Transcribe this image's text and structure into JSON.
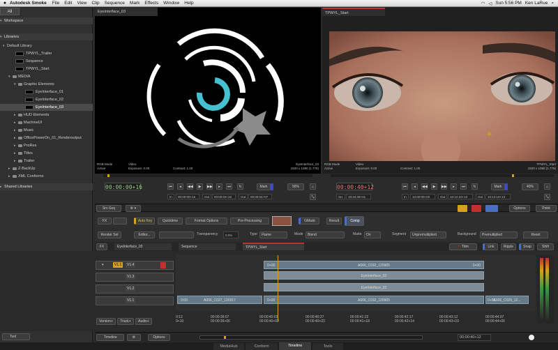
{
  "menubar": {
    "app": "Autodesk Smoke",
    "items": [
      "File",
      "Edit",
      "View",
      "Clip",
      "Sequence",
      "Mark",
      "Effects",
      "Window",
      "Help"
    ],
    "clock": "Sun 5:56 PM",
    "user": "Ken LaRue"
  },
  "library": {
    "tab": "All",
    "workspace": "Workspace",
    "libraries": "Libraries",
    "default_library": "Default Library",
    "tpwyl_trailer": "TPWYL_Trailer",
    "sequence": "Sequence",
    "tpwyl_start": "TPWYL_Start",
    "media": "MEDIA",
    "graphic_elements": "Graphic Elements",
    "eye1": "EyeInterface_01",
    "eye2": "EyeInterface_02",
    "eye3": "EyeInterface_03",
    "hud": "HUD Elements",
    "machineui": "MachineUI",
    "music": "Music",
    "officepower": "OfficePowerOn_01_Renderoutput",
    "prores": "ProRes",
    "titles": "Titles",
    "trailer": "Trailer",
    "zbackup": "Z-BackUp",
    "xml": "XML Conforms",
    "shared": "Shared Libraries"
  },
  "viewerL": {
    "tab": "EyeInterface_03",
    "mode": "RGB Mode",
    "active": "Active",
    "video": "Video",
    "exposure": "Exposure: 0.00",
    "contrast": "Contrast: 1.00",
    "name": "EyeInterface_03",
    "res": "1920 x 1080 (1.778)"
  },
  "viewerR": {
    "tab": "TPWYL_Start",
    "mode": "RGB Mode",
    "active": "Active",
    "video": "Video",
    "exposure": "Exposure: 0.00",
    "contrast": "Contrast: 1.00",
    "name": "TPWYL_Start",
    "res": "1920 x 1080 (1.778)"
  },
  "transportL": {
    "tc": "00:00:00+16",
    "mark": "Mark",
    "zoom": "56%",
    "in_label": "In",
    "in": "00:00:00+16",
    "out_label": "Out",
    "out": "00:00:04+22",
    "out2_label": "Out",
    "out2": "00:00:04+07",
    "srcseq": "Src-Seq"
  },
  "transportR": {
    "tc": "00:00:40+12",
    "mark": "Mark",
    "zoom": "40%",
    "src_label": "Src",
    "src": "19:34:39+01",
    "in_label": "In",
    "in": "10:00:00+00",
    "out_label": "Out",
    "out": "10:12:10+12",
    "out2_label": "Out",
    "out2": "10:12:10+13",
    "options": "Options",
    "pointer": "Point"
  },
  "fx": {
    "fx": "FX",
    "autokey": "Auto Key",
    "quicktime": "Quicktime",
    "format": "Format Options",
    "preproc": "Pre-Processing",
    "gmask": "GMask",
    "result": "Result",
    "comp": "Comp",
    "render": "Render Sel",
    "editor": "Editor...",
    "transparency": "Transparency",
    "transparency_val": "0.0%",
    "type": "Type",
    "type_val": "Flame",
    "mode": "Mode",
    "mode_val": "Blend",
    "matte": "Matte",
    "matte_val": "On",
    "segment": "Segment",
    "segment_val": "Unpremultiplied",
    "background": "Background",
    "background_val": "Premultiplied",
    "reset": "Reset"
  },
  "timeline": {
    "fxtab": "FX",
    "tab1": "EyeInterface_03",
    "tab2": "Sequence",
    "tab3": "TPWYL_Start",
    "trim": "Trim",
    "link": "Link",
    "ripple": "Ripple",
    "snap": "Snap",
    "shift": "Shift",
    "v1": "V1.1",
    "v11": "V1.4",
    "v12": "V1.3",
    "v13": "V1.2",
    "v14": "V1.1",
    "clip_top": "A006_C032_120905",
    "clip_top_l": "0+00",
    "clip_top_r": "0+00",
    "eye_a": "EyeInterface_03",
    "eye_b": "EyeInterface_03",
    "clip_a": "A006_C027_120917",
    "clip_b": "A006_C032_120905",
    "clip_c": "A006_C029_12...",
    "ck": "0:00",
    "ck2": "0+00",
    "ck3": "0+00",
    "version": "Version+",
    "track": "Track+",
    "audio": "Audio+",
    "ruler": [
      [
        "0:12",
        "0+10"
      ],
      [
        "00:00:39:07",
        "00:00:39+06"
      ],
      [
        "00:00:40:03",
        "00:00:40+02"
      ],
      [
        "00:00:40:27",
        "00:00:40+22"
      ],
      [
        "00:00:41:22",
        "00:00:41+18"
      ],
      [
        "00:00:42:17",
        "00:00:42+14"
      ],
      [
        "00:00:43:12",
        "00:00:43+10"
      ],
      [
        "00:00:44:07",
        "00:00:44+06"
      ]
    ],
    "tool": "Tool",
    "bottom_tl": "Timeline",
    "bottom_opt": "Options",
    "bottom_tc": "00:00:40+12"
  },
  "tabs": [
    "MediaHub",
    "Conform",
    "Timeline",
    "Tools"
  ],
  "colors": {
    "accent": "#c0302c",
    "ring": "#45c0cf"
  }
}
